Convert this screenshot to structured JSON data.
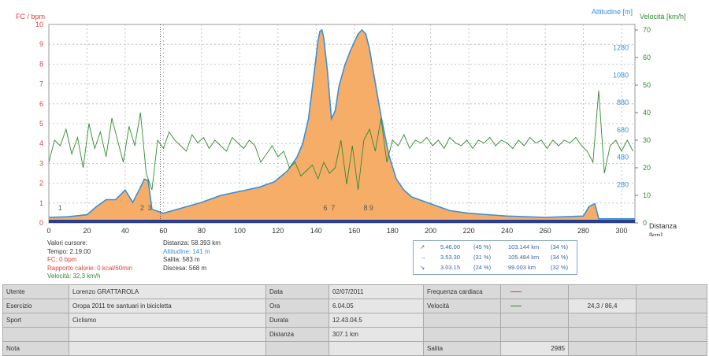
{
  "chart_data": {
    "type": "area",
    "xlabel": "Distanza [km]",
    "x_ticks": [
      0,
      20,
      40,
      60,
      80,
      100,
      120,
      140,
      160,
      180,
      200,
      220,
      240,
      260,
      280,
      300
    ],
    "xlim": [
      0,
      307
    ],
    "left_axis": {
      "label": "FC / bpm",
      "ticks": [
        0,
        1,
        2,
        3,
        4,
        5,
        6,
        7,
        8,
        9,
        10
      ],
      "range": [
        0,
        10
      ],
      "color": "#e0403a"
    },
    "right_axis_altitude": {
      "label": "Altitudine [m]",
      "ticks": [
        280,
        480,
        680,
        880,
        1080,
        1280
      ],
      "range": [
        0,
        1450
      ],
      "color": "#3a8fd8"
    },
    "right_axis_speed": {
      "label": "Velocità [km/h]",
      "ticks": [
        0,
        10,
        20,
        30,
        40,
        50,
        60,
        70
      ],
      "range": [
        0,
        72
      ],
      "color": "#2e8b2e"
    },
    "series": [
      {
        "name": "Altitudine",
        "x": [
          0,
          10,
          20,
          25,
          30,
          35,
          40,
          44,
          48,
          50,
          52,
          54,
          56,
          60,
          70,
          80,
          90,
          100,
          110,
          118,
          125,
          130,
          133,
          136,
          139,
          141,
          142,
          143,
          144,
          146,
          148,
          150,
          152,
          155,
          158,
          162,
          164,
          166,
          168,
          170,
          174,
          178,
          182,
          186,
          190,
          200,
          210,
          220,
          240,
          260,
          280,
          283,
          286,
          288,
          307
        ],
        "y": [
          40,
          45,
          60,
          120,
          170,
          170,
          240,
          150,
          260,
          320,
          310,
          100,
          90,
          70,
          110,
          150,
          200,
          230,
          260,
          300,
          380,
          480,
          580,
          760,
          1100,
          1330,
          1400,
          1410,
          1350,
          1100,
          760,
          820,
          1000,
          1150,
          1260,
          1380,
          1410,
          1380,
          1270,
          1100,
          780,
          500,
          320,
          240,
          190,
          140,
          90,
          70,
          50,
          40,
          50,
          120,
          140,
          30,
          30
        ]
      },
      {
        "name": "Velocità",
        "x": [
          0,
          3,
          6,
          9,
          12,
          15,
          18,
          21,
          24,
          27,
          30,
          33,
          36,
          39,
          42,
          45,
          48,
          51,
          54,
          57,
          60,
          63,
          66,
          69,
          72,
          75,
          78,
          81,
          84,
          87,
          90,
          93,
          96,
          99,
          102,
          105,
          108,
          111,
          114,
          117,
          120,
          123,
          126,
          129,
          132,
          135,
          138,
          141,
          144,
          147,
          150,
          153,
          156,
          159,
          162,
          165,
          168,
          171,
          174,
          177,
          180,
          183,
          186,
          189,
          192,
          195,
          198,
          201,
          204,
          207,
          210,
          213,
          216,
          219,
          222,
          225,
          228,
          231,
          234,
          237,
          240,
          243,
          246,
          249,
          252,
          255,
          258,
          261,
          264,
          267,
          270,
          273,
          276,
          279,
          282,
          285,
          288,
          291,
          294,
          297,
          300,
          303,
          306
        ],
        "y": [
          22,
          30,
          28,
          34,
          25,
          31,
          20,
          36,
          27,
          33,
          24,
          38,
          30,
          22,
          35,
          28,
          40,
          18,
          12,
          30,
          27,
          33,
          30,
          28,
          26,
          32,
          29,
          31,
          27,
          30,
          28,
          26,
          31,
          29,
          27,
          30,
          28,
          22,
          25,
          28,
          24,
          26,
          20,
          22,
          17,
          19,
          21,
          16,
          22,
          18,
          20,
          30,
          14,
          28,
          12,
          30,
          34,
          26,
          38,
          22,
          30,
          28,
          32,
          27,
          30,
          29,
          31,
          28,
          30,
          27,
          31,
          29,
          28,
          30,
          27,
          30,
          29,
          31,
          28,
          30,
          29,
          27,
          30,
          28,
          31,
          29,
          30,
          27,
          30,
          28,
          30,
          29,
          31,
          28,
          26,
          22,
          48,
          18,
          28,
          30,
          26,
          30,
          26
        ]
      }
    ],
    "markers": [
      "1",
      "2",
      "3",
      "6",
      "7",
      "8",
      "9"
    ]
  },
  "cursor": {
    "title": "Valori cursore:",
    "tempo": "Tempo: 2.19.00",
    "fc": "FC: 0 bpm",
    "calorie": "Rapporto calorie: 0 kcal/60min",
    "velocita": "Velocità: 32,3 km/h",
    "distanza": "Distanza: 58.393 km",
    "altitudine": "Altitudine: 141 m",
    "salita": "Salita: 583 m",
    "discesa": "Discesa: 568 m"
  },
  "zones": [
    {
      "icon": "↗",
      "time": "5.46.00",
      "pct1": "(45 %)",
      "km": "103.144 km",
      "pct2": "(34 %)"
    },
    {
      "icon": "→",
      "time": "3.53.30",
      "pct1": "(31 %)",
      "km": "105.484 km",
      "pct2": "(34 %)"
    },
    {
      "icon": "↘",
      "time": "3.03.15",
      "pct1": "(24 %)",
      "km": "99.003 km",
      "pct2": "(32 %)"
    }
  ],
  "summary": {
    "utente_label": "Utente",
    "utente": "Lorenzo GRATTAROLA",
    "esercizio_label": "Esercizio",
    "esercizio": "Oropa 2011 tre santuari in bicicletta",
    "sport_label": "Sport",
    "sport": "Ciclismo",
    "nota_label": "Nota",
    "data_label": "Data",
    "data": "02/07/2011",
    "ora_label": "Ora",
    "ora": "6.04.05",
    "durata_label": "Durata",
    "durata": "12.43.04.5",
    "distanza_label": "Distanza",
    "distanza": "307.1 km",
    "fc_label": "Frequenza cardiaca",
    "vel_label": "Velocità",
    "vel": "24,3 / 86,4",
    "salita_label": "Salita",
    "salita": "2985"
  }
}
